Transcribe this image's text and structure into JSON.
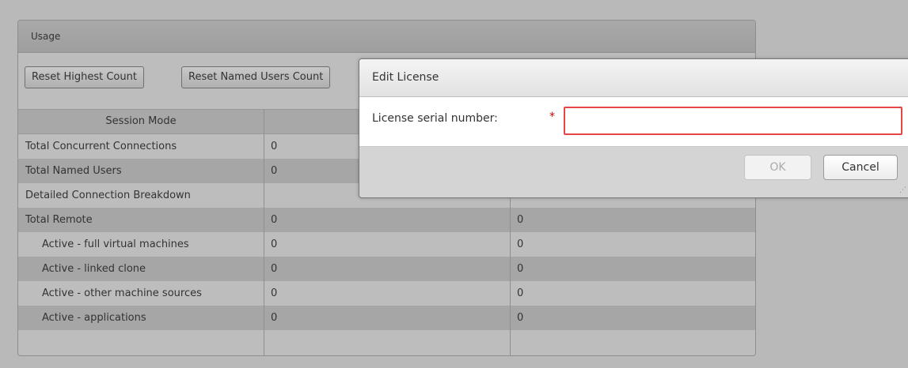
{
  "panel": {
    "title": "Usage",
    "buttons": {
      "reset_highest": "Reset Highest Count",
      "reset_named": "Reset Named Users Count"
    },
    "table": {
      "header_session_mode": "Session Mode",
      "rows": [
        {
          "label": "Total Concurrent Connections",
          "col2": "0",
          "col3": ""
        },
        {
          "label": "Total Named Users",
          "col2": "0",
          "col3": ""
        },
        {
          "label": "Detailed Connection Breakdown",
          "col2": "",
          "col3": ""
        },
        {
          "label": "Total Remote",
          "col2": "0",
          "col3": "0"
        },
        {
          "label": "Active - full virtual machines",
          "col2": "0",
          "col3": "0"
        },
        {
          "label": "Active - linked clone",
          "col2": "0",
          "col3": "0"
        },
        {
          "label": "Active - other machine sources",
          "col2": "0",
          "col3": "0"
        },
        {
          "label": "Active - applications",
          "col2": "0",
          "col3": "0"
        }
      ]
    }
  },
  "dialog": {
    "title": "Edit License",
    "serial_label": "License serial number:",
    "required_marker": "*",
    "serial_value": "",
    "ok_label": "OK",
    "cancel_label": "Cancel",
    "resize_grip": "⋰"
  }
}
